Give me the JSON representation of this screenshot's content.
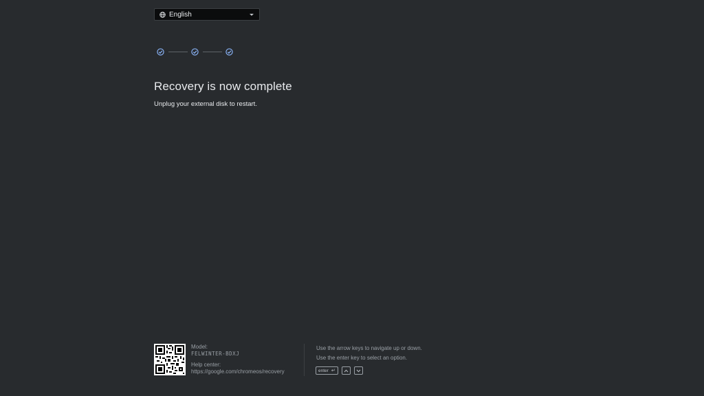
{
  "language_select": {
    "selected": "English",
    "icon": "globe-icon"
  },
  "stepper": {
    "steps": [
      {
        "state": "complete",
        "icon": "check-circle-icon"
      },
      {
        "state": "complete",
        "icon": "check-circle-icon"
      },
      {
        "state": "complete",
        "icon": "check-circle-icon"
      }
    ],
    "accent_color": "#8ab4f8"
  },
  "main": {
    "title": "Recovery is now complete",
    "subtitle": "Unplug your external disk to restart."
  },
  "footer": {
    "model_label": "Model:",
    "model_value": "FELWINTER-BDXJ",
    "help_label": "Help center:",
    "help_url": "https://google.com/chromeos/recovery",
    "nav_help_line1": "Use the arrow keys to navigate up or down.",
    "nav_help_line2": "Use the enter key to select an option.",
    "keys": {
      "enter_label": "enter",
      "enter_glyph": "↵",
      "up_glyph": "^",
      "down_glyph": "v"
    }
  }
}
